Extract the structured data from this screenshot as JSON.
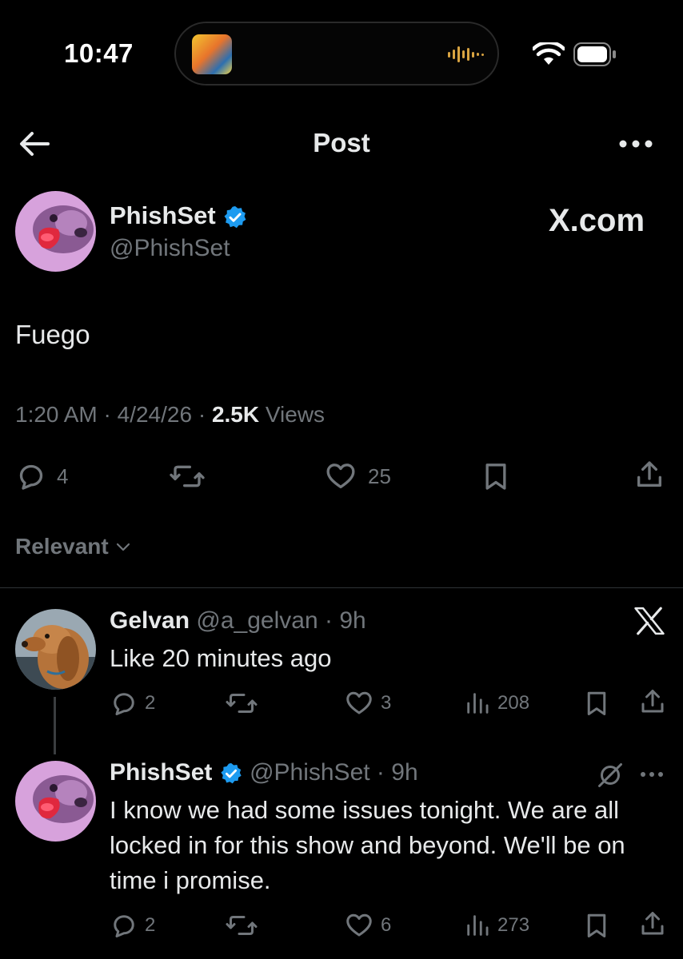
{
  "status_bar": {
    "time": "10:47"
  },
  "header": {
    "title": "Post"
  },
  "post": {
    "name": "PhishSet",
    "handle": "@PhishSet",
    "watermark": "X.com",
    "text": "Fuego",
    "time": "1:20 AM",
    "date": "4/24/26",
    "views_count": "2.5K",
    "views_label": "Views",
    "replies": "4",
    "likes": "25"
  },
  "sort": {
    "label": "Relevant"
  },
  "replies": [
    {
      "name": "Gelvan",
      "handle": "@a_gelvan",
      "age": "9h",
      "text": "Like 20 minutes ago",
      "replies": "2",
      "likes": "3",
      "views": "208"
    },
    {
      "name": "PhishSet",
      "handle": "@PhishSet",
      "age": "9h",
      "text": "I know we had some issues tonight. We are all locked in for this show and beyond. We'll be on time i promise.",
      "replies": "2",
      "likes": "6",
      "views": "273"
    }
  ],
  "icons": [
    "back-arrow-icon",
    "more-icon",
    "verified-badge-icon",
    "reply-icon",
    "repost-icon",
    "like-icon",
    "bookmark-icon",
    "share-icon",
    "views-icon",
    "x-logo-icon",
    "chevron-down-icon",
    "hide-icon",
    "wifi-icon",
    "battery-icon",
    "waveform-icon"
  ],
  "colors": {
    "background": "#000000",
    "text": "#e7e9ea",
    "muted": "#71767b",
    "verified": "#1d9bf0",
    "divider": "#2f3336",
    "waveform": "#d9a441"
  }
}
